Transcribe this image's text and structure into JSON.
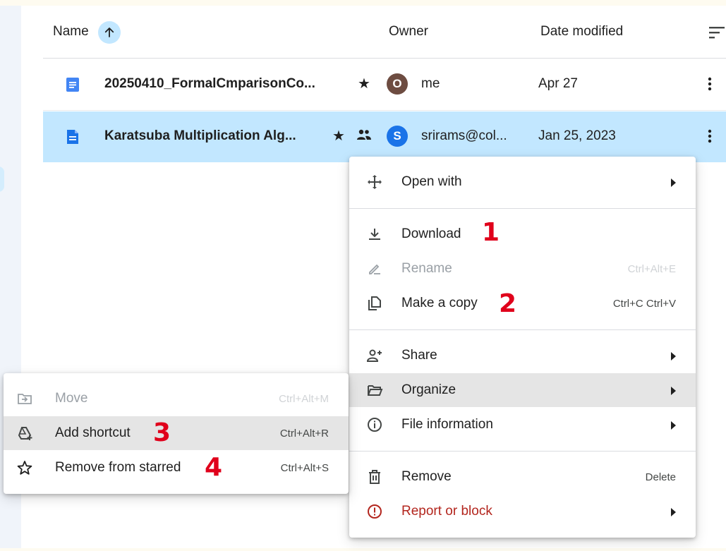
{
  "header": {
    "name_label": "Name",
    "owner_label": "Owner",
    "date_label": "Date modified"
  },
  "files": [
    {
      "name": "20250410_FormalCmparisonCo...",
      "owner_initial": "O",
      "owner": "me",
      "date": "Apr 27",
      "avatar_color": "#6d4c41",
      "starred": true,
      "shared": false
    },
    {
      "name": "Karatsuba Multiplication Alg...",
      "owner_initial": "S",
      "owner": "srirams@col...",
      "date": "Jan 25, 2023",
      "avatar_color": "#1a73e8",
      "starred": true,
      "shared": true
    }
  ],
  "context_menu": {
    "open_with": "Open with",
    "download": "Download",
    "rename": "Rename",
    "rename_shortcut": "Ctrl+Alt+E",
    "make_copy": "Make a copy",
    "make_copy_shortcut": "Ctrl+C Ctrl+V",
    "share": "Share",
    "organize": "Organize",
    "file_information": "File information",
    "remove": "Remove",
    "remove_shortcut": "Delete",
    "report": "Report or block"
  },
  "organize_submenu": {
    "move": "Move",
    "move_shortcut": "Ctrl+Alt+M",
    "add_shortcut": "Add shortcut",
    "add_shortcut_shortcut": "Ctrl+Alt+R",
    "remove_starred": "Remove from starred",
    "remove_starred_shortcut": "Ctrl+Alt+S"
  },
  "annotations": [
    "1",
    "2",
    "3",
    "4"
  ],
  "colors": {
    "selected_row": "#c2e7ff",
    "accent_blue": "#1a73e8",
    "danger_red": "#b3261e",
    "annotation_red": "#e0001b",
    "menu_highlight": "#e5e5e5"
  }
}
